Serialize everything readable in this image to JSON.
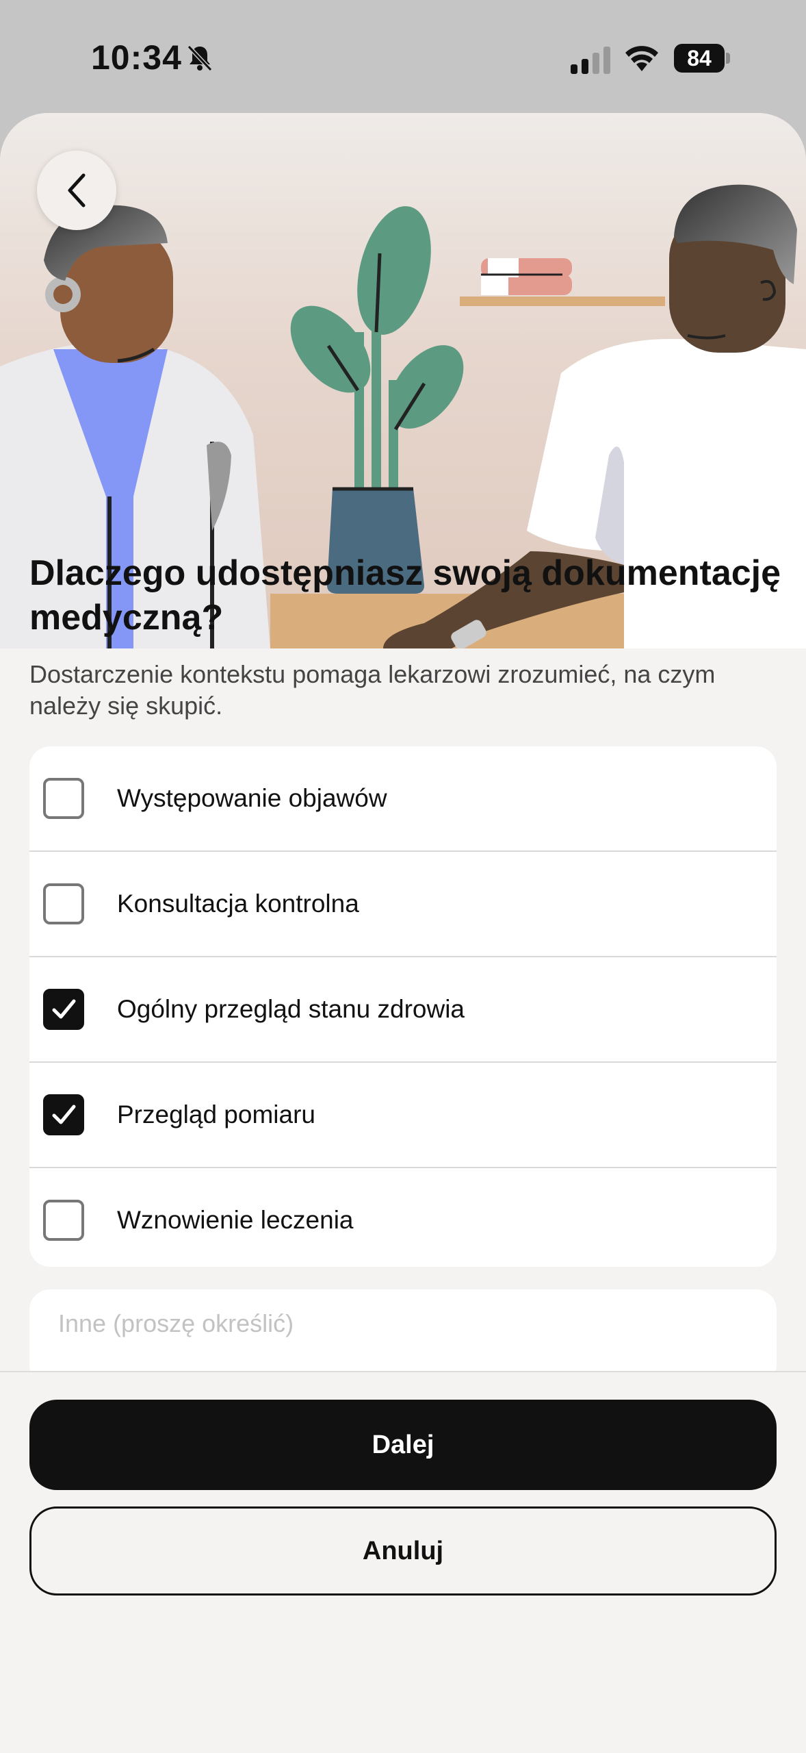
{
  "status_bar": {
    "time": "10:34",
    "battery": "84",
    "icons": [
      "bell-slash-icon",
      "cellular-signal-icon",
      "wifi-icon",
      "battery-icon"
    ]
  },
  "header": {
    "back_icon": "chevron-left-icon"
  },
  "main": {
    "title": "Dlaczego udostępniasz swoją dokumentację medyczną?",
    "subtitle": "Dostarczenie kontekstu pomaga lekarzowi zrozumieć, na czym należy się skupić.",
    "options": [
      {
        "label": "Występowanie objawów",
        "checked": false
      },
      {
        "label": "Konsultacja kontrolna",
        "checked": false
      },
      {
        "label": "Ogólny przegląd stanu zdrowia",
        "checked": true
      },
      {
        "label": "Przegląd pomiaru",
        "checked": true
      },
      {
        "label": "Wznowienie leczenia",
        "checked": false
      }
    ],
    "other_placeholder": "Inne (proszę określić)",
    "other_value": ""
  },
  "footer": {
    "next_label": "Dalej",
    "cancel_label": "Anuluj"
  },
  "colors": {
    "primary": "#111111",
    "background": "#f4f3f1",
    "card": "#ffffff",
    "hero_wall": "#e2cfc5",
    "accent_blue": "#8597f6",
    "plant_green": "#5c9a82"
  }
}
